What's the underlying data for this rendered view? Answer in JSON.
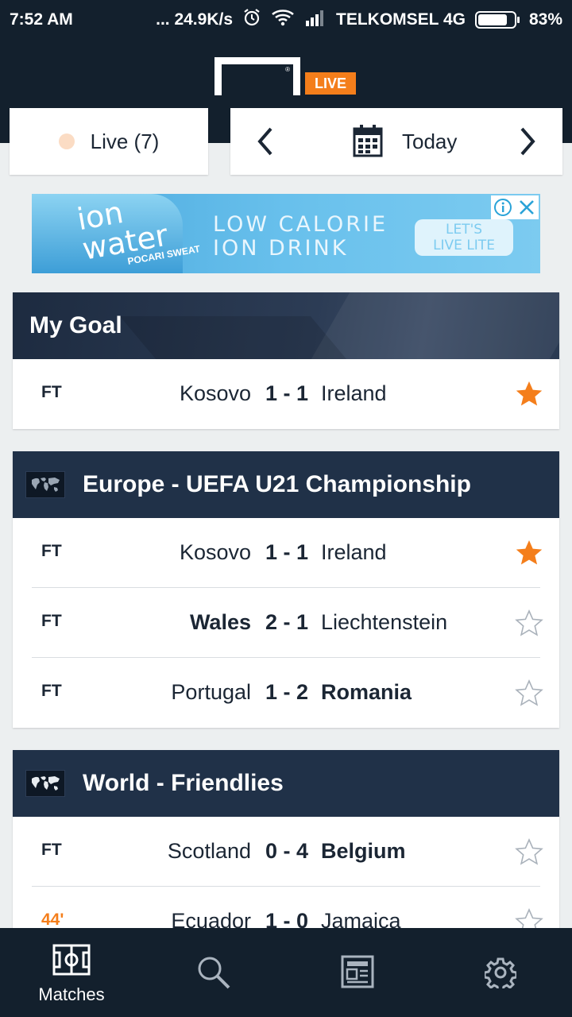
{
  "status_bar": {
    "time": "7:52 AM",
    "net_speed": "... 24.9K/s",
    "carrier": "TELKOMSEL 4G",
    "battery": "83%",
    "battery_level": 0.83,
    "icons": [
      "alarm-icon",
      "wifi-icon",
      "signal-icon",
      "battery-icon"
    ]
  },
  "header": {
    "live_badge": "LIVE",
    "logo_mark": "®"
  },
  "filters": {
    "live_label": "Live (7)",
    "date_label": "Today"
  },
  "ad": {
    "bottle_text": "ion\nwater",
    "brand": "POCARI SWEAT",
    "headline": "LOW CALORIE\nION DRINK",
    "cta": "LET'S\nLIVE LITE"
  },
  "sections": [
    {
      "title": "My Goal",
      "matches": [
        {
          "status": "FT",
          "home": "Kosovo",
          "score": "1 - 1",
          "away": "Ireland",
          "starred": true
        }
      ]
    },
    {
      "title": "Europe - UEFA U21 Championship",
      "matches": [
        {
          "status": "FT",
          "home": "Kosovo",
          "score": "1 - 1",
          "away": "Ireland",
          "starred": true
        },
        {
          "status": "FT",
          "home": "Wales",
          "score": "2 - 1",
          "away": "Liechtenstein",
          "starred": false
        },
        {
          "status": "FT",
          "home": "Portugal",
          "score": "1 - 2",
          "away": "Romania",
          "starred": false
        }
      ]
    },
    {
      "title": "World - Friendlies",
      "matches": [
        {
          "status": "FT",
          "home": "Scotland",
          "score": "0 - 4",
          "away": "Belgium",
          "starred": false
        },
        {
          "status": "44'",
          "home": "Ecuador",
          "score": "1 - 0",
          "away": "Jamaica",
          "starred": false
        }
      ]
    }
  ],
  "bottom_nav": {
    "matches_label": "Matches"
  },
  "colors": {
    "accent": "#f47e1b",
    "header_bg": "#13202d",
    "section_bg": "#203148"
  }
}
